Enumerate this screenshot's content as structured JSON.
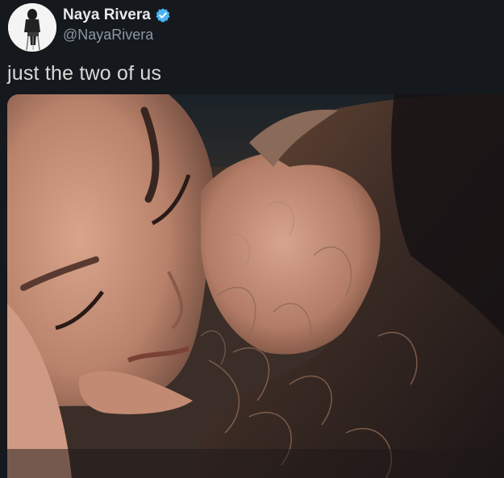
{
  "tweet": {
    "author_name": "Naya Rivera",
    "author_handle": "@NayaRivera",
    "text": "just the two of us",
    "verified_color": "#4ab3f4"
  },
  "icons": {
    "verified": "verified-badge-icon"
  },
  "colors": {
    "background": "#15181c",
    "name": "#e7e9ea",
    "handle": "#8b98a5",
    "text": "#d9d9d9"
  }
}
